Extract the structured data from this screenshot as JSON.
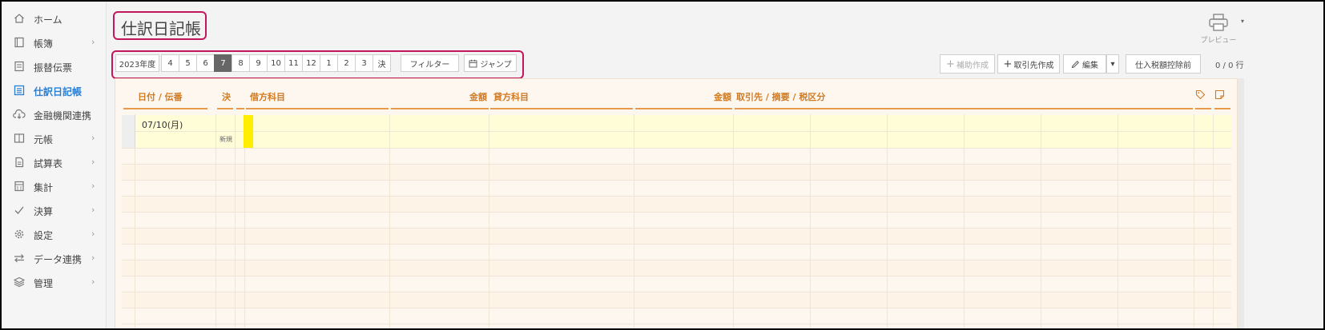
{
  "sidebar": {
    "items": [
      {
        "label": "ホーム",
        "icon": "home-icon",
        "chevron": ""
      },
      {
        "label": "帳簿",
        "icon": "book-icon",
        "chevron": "›"
      },
      {
        "label": "振替伝票",
        "icon": "voucher-icon",
        "chevron": ""
      },
      {
        "label": "仕訳日記帳",
        "icon": "list-icon",
        "chevron": "",
        "active": true
      },
      {
        "label": "金融機関連携",
        "icon": "cloud-download-icon",
        "chevron": ""
      },
      {
        "label": "元帳",
        "icon": "columns-icon",
        "chevron": "›"
      },
      {
        "label": "試算表",
        "icon": "document-icon",
        "chevron": "›"
      },
      {
        "label": "集計",
        "icon": "calculator-icon",
        "chevron": "›"
      },
      {
        "label": "決算",
        "icon": "check-icon",
        "chevron": "›"
      },
      {
        "label": "設定",
        "icon": "gear-icon",
        "chevron": "›"
      },
      {
        "label": "データ連携",
        "icon": "swap-icon",
        "chevron": "›"
      },
      {
        "label": "管理",
        "icon": "layers-icon",
        "chevron": "›"
      }
    ]
  },
  "header": {
    "title": "仕訳日記帳",
    "preview_label": "プレビュー",
    "preview_caret": "▾"
  },
  "toolbar": {
    "year": "2023年度",
    "months": [
      "4",
      "5",
      "6",
      "7",
      "8",
      "9",
      "10",
      "11",
      "12",
      "1",
      "2",
      "3",
      "決"
    ],
    "selected_month": "7",
    "filter": "フィルター",
    "jump": "ジャンプ",
    "sub_create": "補助作成",
    "partner_create": "取引先作成",
    "edit": "編集",
    "edit_caret": "▾",
    "tax_mode": "仕入税額控除前",
    "row_count": "0 / 0 行"
  },
  "journal": {
    "headers": {
      "date_no": "日付 / 伝番",
      "settle": "決",
      "debit_account": "借方科目",
      "debit_amount": "金額",
      "credit_account": "貸方科目",
      "credit_amount": "金額",
      "partner_summary_tax": "取引先 / 摘要 / 税区分"
    },
    "entry": {
      "date": "07/10(月)",
      "status": "新規"
    }
  },
  "colors": {
    "accent": "#d07a22",
    "active_nav": "#2a7fd4",
    "highlight": "#c2185b",
    "yellow_marker": "#ffee00"
  }
}
